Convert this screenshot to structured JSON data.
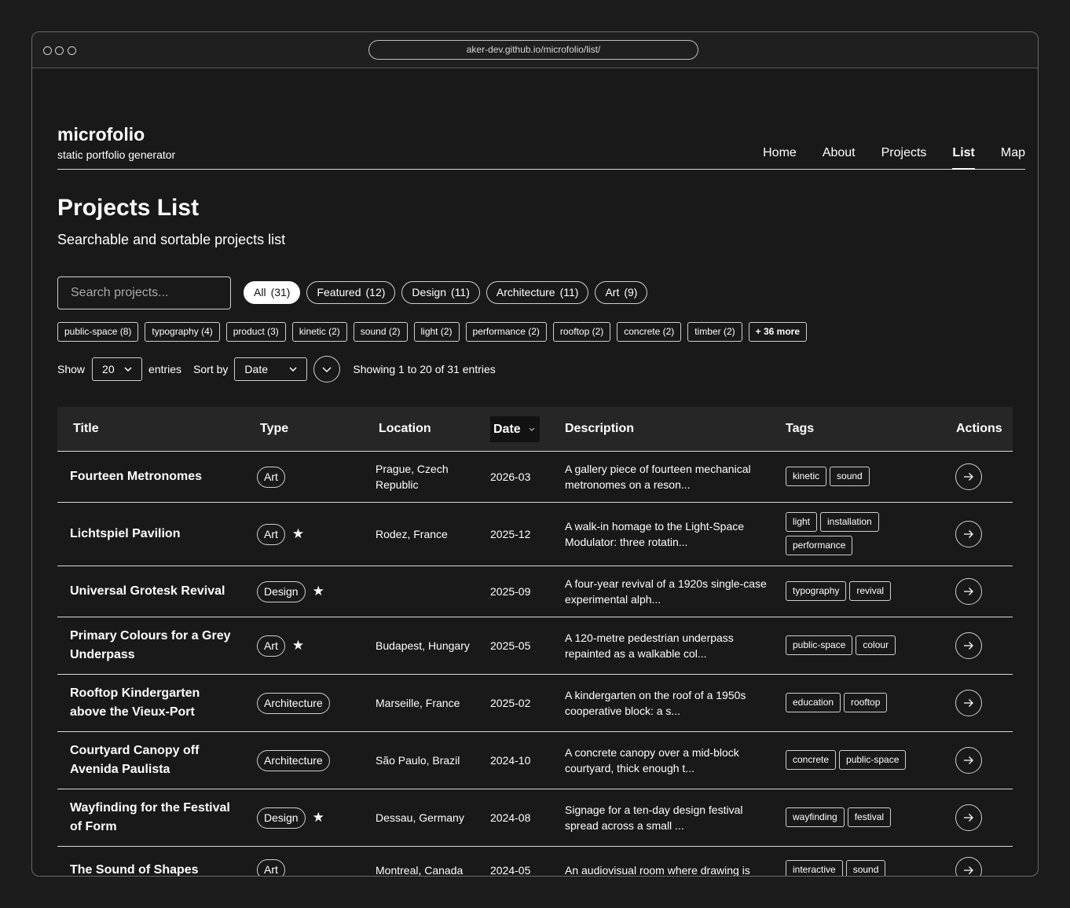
{
  "browser": {
    "url": "aker-dev.github.io/microfolio/list/"
  },
  "site": {
    "title": "microfolio",
    "subtitle": "static portfolio generator"
  },
  "nav": [
    {
      "label": "Home",
      "active": false
    },
    {
      "label": "About",
      "active": false
    },
    {
      "label": "Projects",
      "active": false
    },
    {
      "label": "List",
      "active": true
    },
    {
      "label": "Map",
      "active": false
    }
  ],
  "page": {
    "title": "Projects List",
    "subtitle": "Searchable and sortable projects list"
  },
  "search": {
    "placeholder": "Search projects..."
  },
  "type_filters": [
    {
      "label": "All",
      "count": "(31)",
      "active": true
    },
    {
      "label": "Featured",
      "count": "(12)",
      "active": false
    },
    {
      "label": "Design",
      "count": "(11)",
      "active": false
    },
    {
      "label": "Architecture",
      "count": "(11)",
      "active": false
    },
    {
      "label": "Art",
      "count": "(9)",
      "active": false
    }
  ],
  "tag_filters": [
    "public-space (8)",
    "typography (4)",
    "product (3)",
    "kinetic (2)",
    "sound (2)",
    "light (2)",
    "performance (2)",
    "rooftop (2)",
    "concrete (2)",
    "timber (2)"
  ],
  "tag_filters_more": "+ 36 more",
  "controls": {
    "show_label": "Show",
    "entries_value": "20",
    "entries_label": "entries",
    "sort_label": "Sort by",
    "sort_value": "Date",
    "showing_text": "Showing 1 to 20 of 31 entries"
  },
  "table": {
    "headers": {
      "title": "Title",
      "type": "Type",
      "location": "Location",
      "date": "Date",
      "description": "Description",
      "tags": "Tags",
      "actions": "Actions"
    },
    "rows": [
      {
        "title": "Fourteen Metronomes",
        "type": "Art",
        "featured": false,
        "location": "Prague, Czech Republic",
        "date": "2026-03",
        "description": "A gallery piece of fourteen mechanical metronomes on a reson...",
        "tags": [
          "kinetic",
          "sound"
        ]
      },
      {
        "title": "Lichtspiel Pavilion",
        "type": "Art",
        "featured": true,
        "location": "Rodez, France",
        "date": "2025-12",
        "description": "A walk-in homage to the Light-Space Modulator: three rotatin...",
        "tags": [
          "light",
          "installation",
          "performance"
        ]
      },
      {
        "title": "Universal Grotesk Revival",
        "type": "Design",
        "featured": true,
        "location": "",
        "date": "2025-09",
        "description": "A four-year revival of a 1920s single-case experimental alph...",
        "tags": [
          "typography",
          "revival"
        ]
      },
      {
        "title": "Primary Colours for a Grey Underpass",
        "type": "Art",
        "featured": true,
        "location": "Budapest, Hungary",
        "date": "2025-05",
        "description": "A 120-metre pedestrian underpass repainted as a walkable col...",
        "tags": [
          "public-space",
          "colour"
        ]
      },
      {
        "title": "Rooftop Kindergarten above the Vieux-Port",
        "type": "Architecture",
        "featured": false,
        "location": "Marseille, France",
        "date": "2025-02",
        "description": "A kindergarten on the roof of a 1950s cooperative block: a s...",
        "tags": [
          "education",
          "rooftop"
        ]
      },
      {
        "title": "Courtyard Canopy off Avenida Paulista",
        "type": "Architecture",
        "featured": false,
        "location": "São Paulo, Brazil",
        "date": "2024-10",
        "description": "A concrete canopy over a mid-block courtyard, thick enough t...",
        "tags": [
          "concrete",
          "public-space"
        ]
      },
      {
        "title": "Wayfinding for the Festival of Form",
        "type": "Design",
        "featured": true,
        "location": "Dessau, Germany",
        "date": "2024-08",
        "description": "Signage for a ten-day design festival spread across a small ...",
        "tags": [
          "wayfinding",
          "festival"
        ]
      },
      {
        "title": "The Sound of Shapes",
        "type": "Art",
        "featured": false,
        "location": "Montreal, Canada",
        "date": "2024-05",
        "description": "An audiovisual room where drawing is",
        "tags": [
          "interactive",
          "sound"
        ]
      }
    ]
  },
  "icons": {
    "star": "star-icon",
    "arrow": "arrow-right-icon",
    "chevron": "chevron-down-icon"
  }
}
